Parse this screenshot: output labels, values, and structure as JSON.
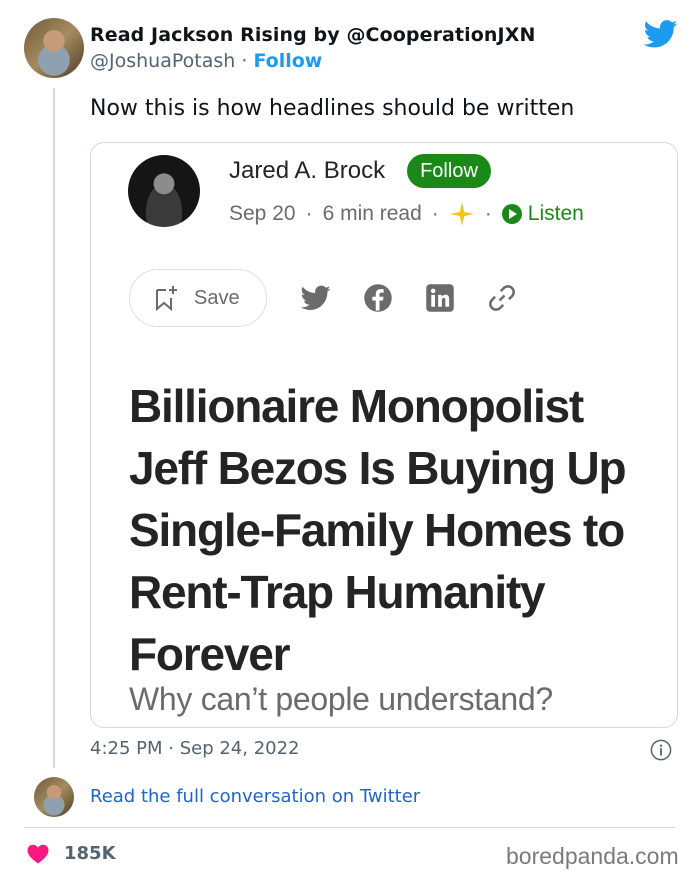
{
  "tweet": {
    "display_name": "Read Jackson Rising by @CooperationJXN",
    "handle": "@JoshuaPotash",
    "separator": "·",
    "follow_label": "Follow",
    "text": "Now this is how headlines should be written",
    "timestamp": "4:25 PM · Sep 24, 2022",
    "read_conversation": "Read the full conversation on Twitter",
    "likes": "185K",
    "brand_color": "#1d9bf0"
  },
  "article": {
    "author": "Jared A. Brock",
    "follow_label": "Follow",
    "date": "Sep 20",
    "read_time": "6 min read",
    "dot": "·",
    "listen_label": "Listen",
    "save_label": "Save",
    "headline": "Billionaire Monopolist Jeff Bezos Is Buying Up Single-Family Homes to Rent-Trap Humanity Forever",
    "subtitle": "Why can’t people understand?",
    "accent_color": "#1a8917",
    "share_icons": [
      "twitter-icon",
      "facebook-icon",
      "linkedin-icon",
      "link-icon"
    ]
  },
  "watermark": "boredpanda.com"
}
